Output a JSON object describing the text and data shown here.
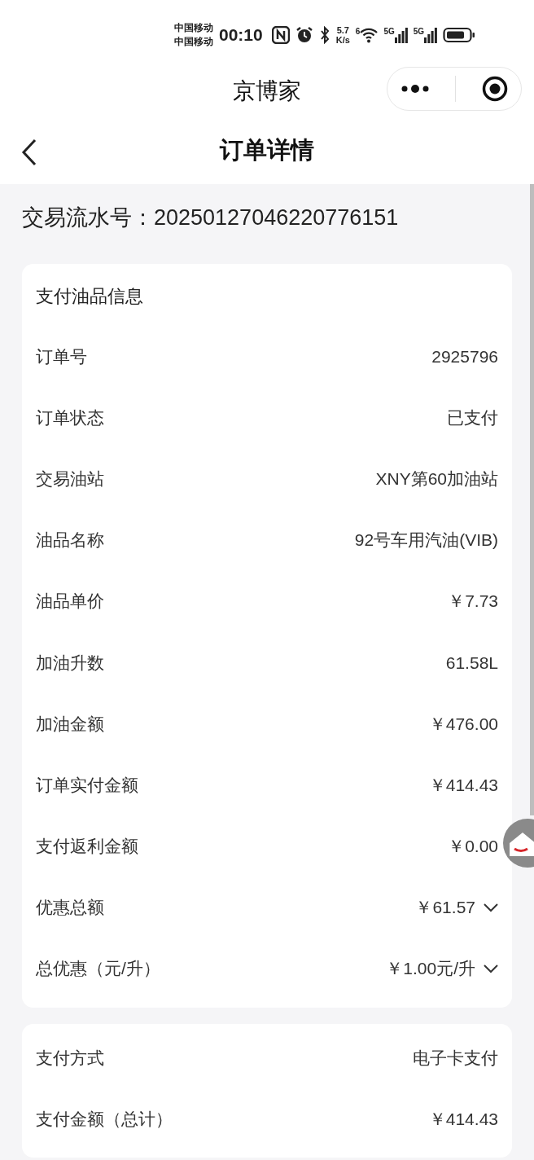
{
  "status_bar": {
    "carriers": [
      "中国移动",
      "中国移动"
    ],
    "time": "00:10",
    "speed": [
      "5.7",
      "K/s"
    ],
    "wifi_label": "6",
    "networks": [
      "5G",
      "5G"
    ]
  },
  "app_bar": {
    "title": "京博家"
  },
  "nav": {
    "title": "订单详情"
  },
  "serial": {
    "label": "交易流水号：",
    "value": "20250127046220776151"
  },
  "cards": [
    {
      "title": "支付油品信息",
      "rows": [
        {
          "label": "订单号",
          "value": "2925796"
        },
        {
          "label": "订单状态",
          "value": "已支付"
        },
        {
          "label": "交易油站",
          "value": "XNY第60加油站"
        },
        {
          "label": "油品名称",
          "value": "92号车用汽油(VIB)"
        },
        {
          "label": "油品单价",
          "value": "￥7.73"
        },
        {
          "label": "加油升数",
          "value": "61.58L"
        },
        {
          "label": "加油金额",
          "value": "￥476.00"
        },
        {
          "label": "订单实付金额",
          "value": "￥414.43"
        },
        {
          "label": "支付返利金额",
          "value": "￥0.00"
        },
        {
          "label": "优惠总额",
          "value": "￥61.57",
          "expanded": false
        },
        {
          "label": "总优惠（元/升）",
          "value": "￥1.00元/升",
          "expanded": false
        }
      ]
    },
    {
      "rows": [
        {
          "label": "支付方式",
          "value": "电子卡支付"
        },
        {
          "label": "支付金额（总计）",
          "value": "￥414.43"
        }
      ]
    }
  ]
}
